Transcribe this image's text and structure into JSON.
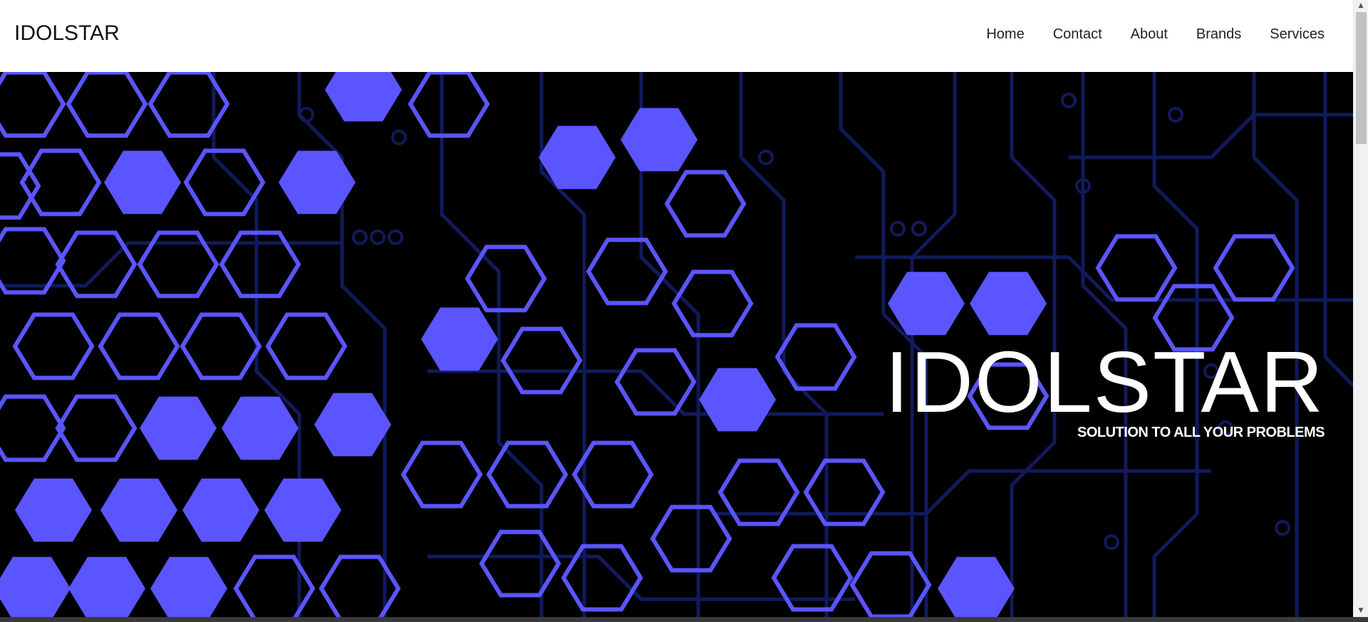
{
  "header": {
    "brand": "IDOLSTAR",
    "nav": [
      {
        "label": "Home"
      },
      {
        "label": "Contact"
      },
      {
        "label": "About"
      },
      {
        "label": "Brands"
      },
      {
        "label": "Services"
      }
    ]
  },
  "hero": {
    "title": "IDOLSTAR",
    "subtitle": "SOLUTION TO ALL YOUR PROBLEMS",
    "background_image": "circuit-hexagon-pattern"
  },
  "colors": {
    "accent": "#5a55ff",
    "trace": "#121a5c",
    "hero_bg": "#000000",
    "nav_bg": "#ffffff"
  },
  "scrollbar": {
    "up_icon": "arrow-up-icon",
    "down_icon": "arrow-down-icon"
  }
}
